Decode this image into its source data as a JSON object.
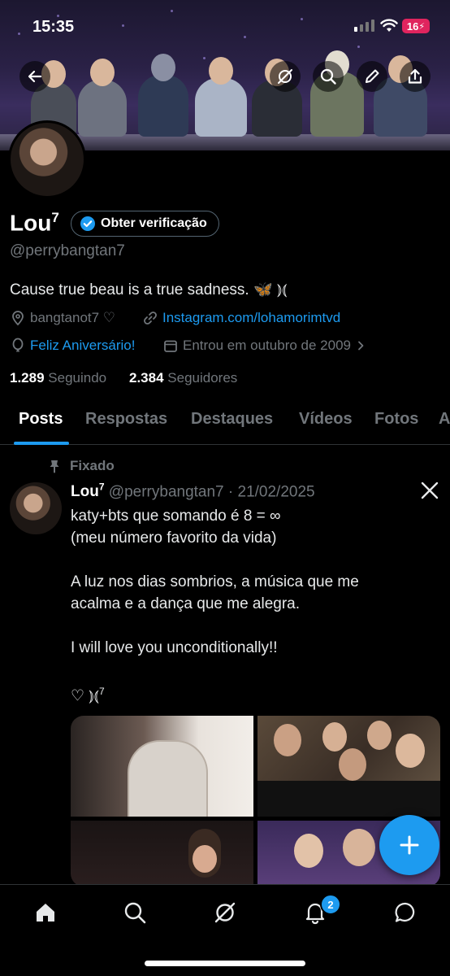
{
  "status_bar": {
    "time": "15:35",
    "battery": "16"
  },
  "profile": {
    "name": "Lou",
    "name_sup": "7",
    "verify_label": "Obter verificação",
    "handle": "@perrybangtan7",
    "bio": "Cause true beau is a true sadness. 🦋 ⦆⦅",
    "location": "bangtanot7 ♡",
    "website": "Instagram.com/lohamorimtvd",
    "birthday": "Feliz Aniversário!",
    "joined": "Entrou em outubro de 2009",
    "following_count": "1.289",
    "following_label": "Seguindo",
    "followers_count": "2.384",
    "followers_label": "Seguidores"
  },
  "tabs": [
    {
      "label": "Posts"
    },
    {
      "label": "Respostas"
    },
    {
      "label": "Destaques"
    },
    {
      "label": "Vídeos"
    },
    {
      "label": "Fotos"
    },
    {
      "label": "A"
    }
  ],
  "pinned_tweet": {
    "pinned_label": "Fixado",
    "author": "Lou",
    "author_sup": "7",
    "meta": "@perrybangtan7 · 21/02/2025",
    "line1": "katy+bts que somando é 8 = ∞",
    "line2": "(meu número favorito da vida)",
    "line3": "A luz nos dias sombrios, a música que me",
    "line4": "acalma e a dança que me alegra.",
    "line5": "I will love you unconditionally!!",
    "line6": "♡ ⦆⦅",
    "line6_sup": "7"
  },
  "nav": {
    "notifications_badge": "2"
  },
  "colors": {
    "accent": "#1d9bf0",
    "background": "#000000",
    "muted": "#71767b"
  }
}
